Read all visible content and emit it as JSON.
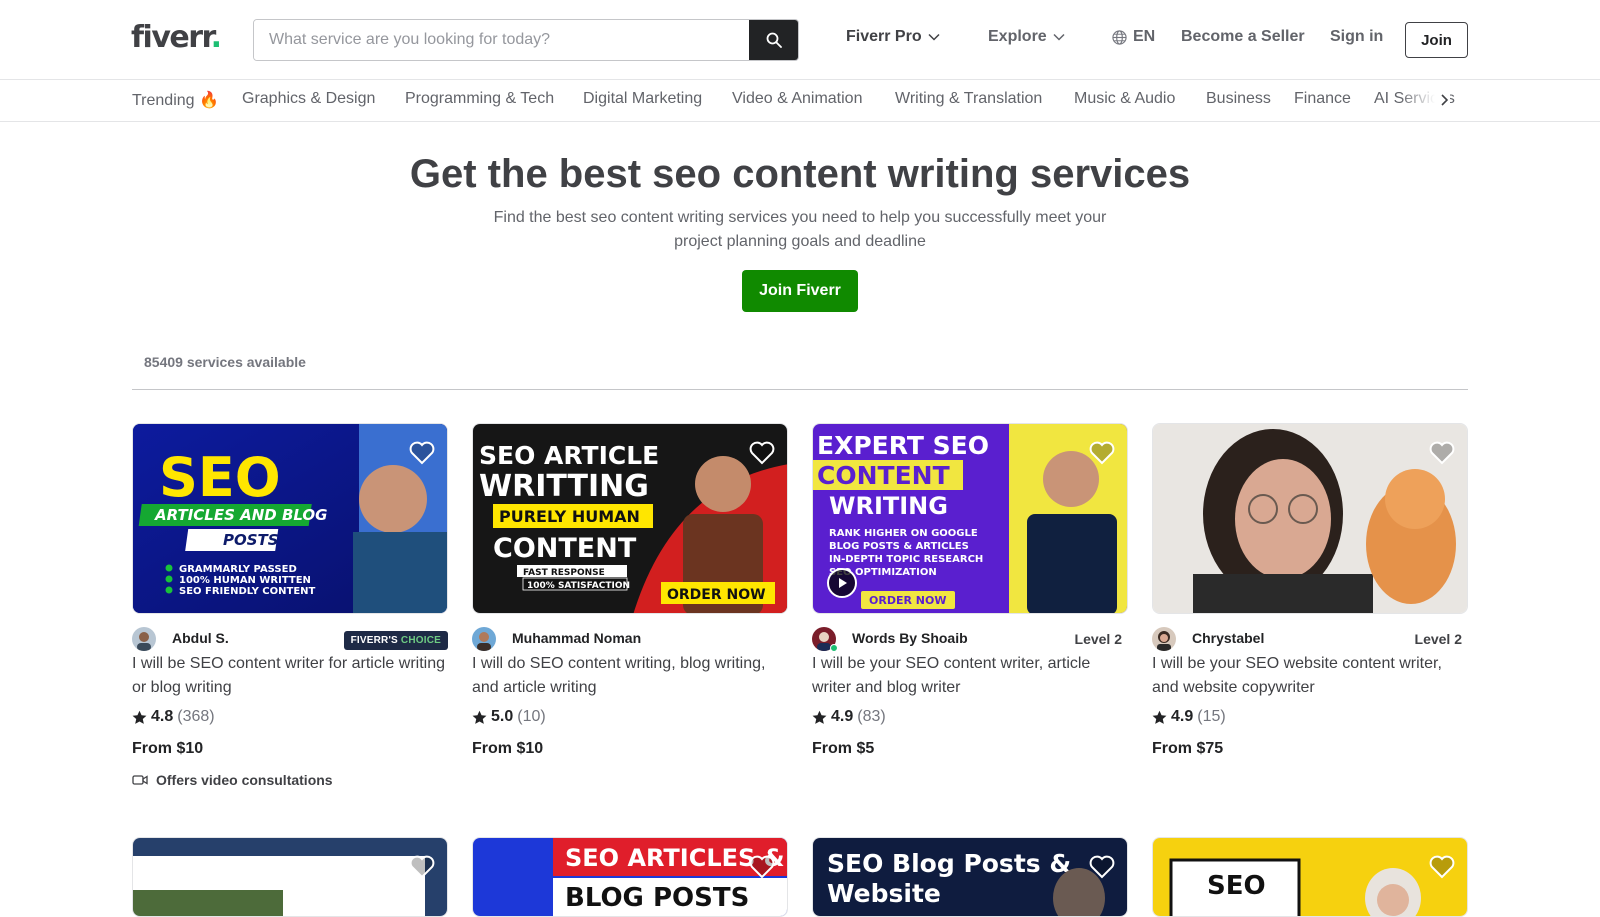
{
  "header": {
    "logo": "fiverr",
    "logo_dot": ".",
    "search_placeholder": "What service are you looking for today?",
    "nav": {
      "fiverr_pro": "Fiverr Pro",
      "explore": "Explore",
      "language": "EN",
      "become_seller": "Become a Seller",
      "sign_in": "Sign in",
      "join": "Join"
    }
  },
  "categories": [
    "Trending 🔥",
    "Graphics & Design",
    "Programming & Tech",
    "Digital Marketing",
    "Video & Animation",
    "Writing & Translation",
    "Music & Audio",
    "Business",
    "Finance",
    "AI Services"
  ],
  "hero": {
    "title": "Get the best seo content writing services",
    "subtitle": "Find the best seo content writing services you need to help you successfully meet your project planning goals and deadline",
    "cta": "Join Fiverr"
  },
  "results": {
    "count": "85409 services available"
  },
  "gigs": [
    {
      "seller": "Abdul S.",
      "badge_prefix": "FIVERR'S",
      "badge_suffix": "CHOICE",
      "title": "I will be SEO content writer for article writing or blog writing",
      "rating": "4.8",
      "reviews": "(368)",
      "price": "From $10",
      "extra": "Offers video consultations",
      "thumb_text": [
        "SEO",
        "ARTICLES AND BLOG",
        "POSTS",
        "GRAMMARLY PASSED",
        "100% HUMAN WRITTEN",
        "SEO FRIENDLY CONTENT"
      ]
    },
    {
      "seller": "Muhammad Noman",
      "title": "I will do SEO content writing, blog writing, and article writing",
      "rating": "5.0",
      "reviews": "(10)",
      "price": "From $10",
      "thumb_text": [
        "SEO ARTICLE",
        "WRITTING",
        "PURELY HUMAN",
        "CONTENT",
        "FAST RESPONSE",
        "100% SATISFACTION",
        "ORDER NOW"
      ]
    },
    {
      "seller": "Words By Shoaib",
      "level": "Level 2",
      "title": "I will be your SEO content writer, article writer and blog writer",
      "rating": "4.9",
      "reviews": "(83)",
      "price": "From $5",
      "thumb_text": [
        "EXPERT SEO",
        "CONTENT",
        "WRITING",
        "RANK HIGHER ON GOOGLE",
        "BLOG POSTS & ARTICLES",
        "IN-DEPTH TOPIC RESEARCH",
        "SEO OPTIMIZATION",
        "ORDER NOW"
      ]
    },
    {
      "seller": "Chrystabel",
      "level": "Level 2",
      "title": "I will be your SEO website content writer, and website copywriter",
      "rating": "4.9",
      "reviews": "(15)",
      "price": "From $75"
    }
  ],
  "row2_thumbs": [
    {
      "text": ""
    },
    {
      "text": [
        "SEO ARTICLES &",
        "BLOG POSTS"
      ]
    },
    {
      "text": [
        "SEO Blog Posts &",
        "Website"
      ]
    },
    {
      "text": [
        "SEO"
      ]
    }
  ],
  "colors": {
    "brand_green": "#1dbf73",
    "cta_green": "#108a00",
    "text_dark": "#404145"
  }
}
